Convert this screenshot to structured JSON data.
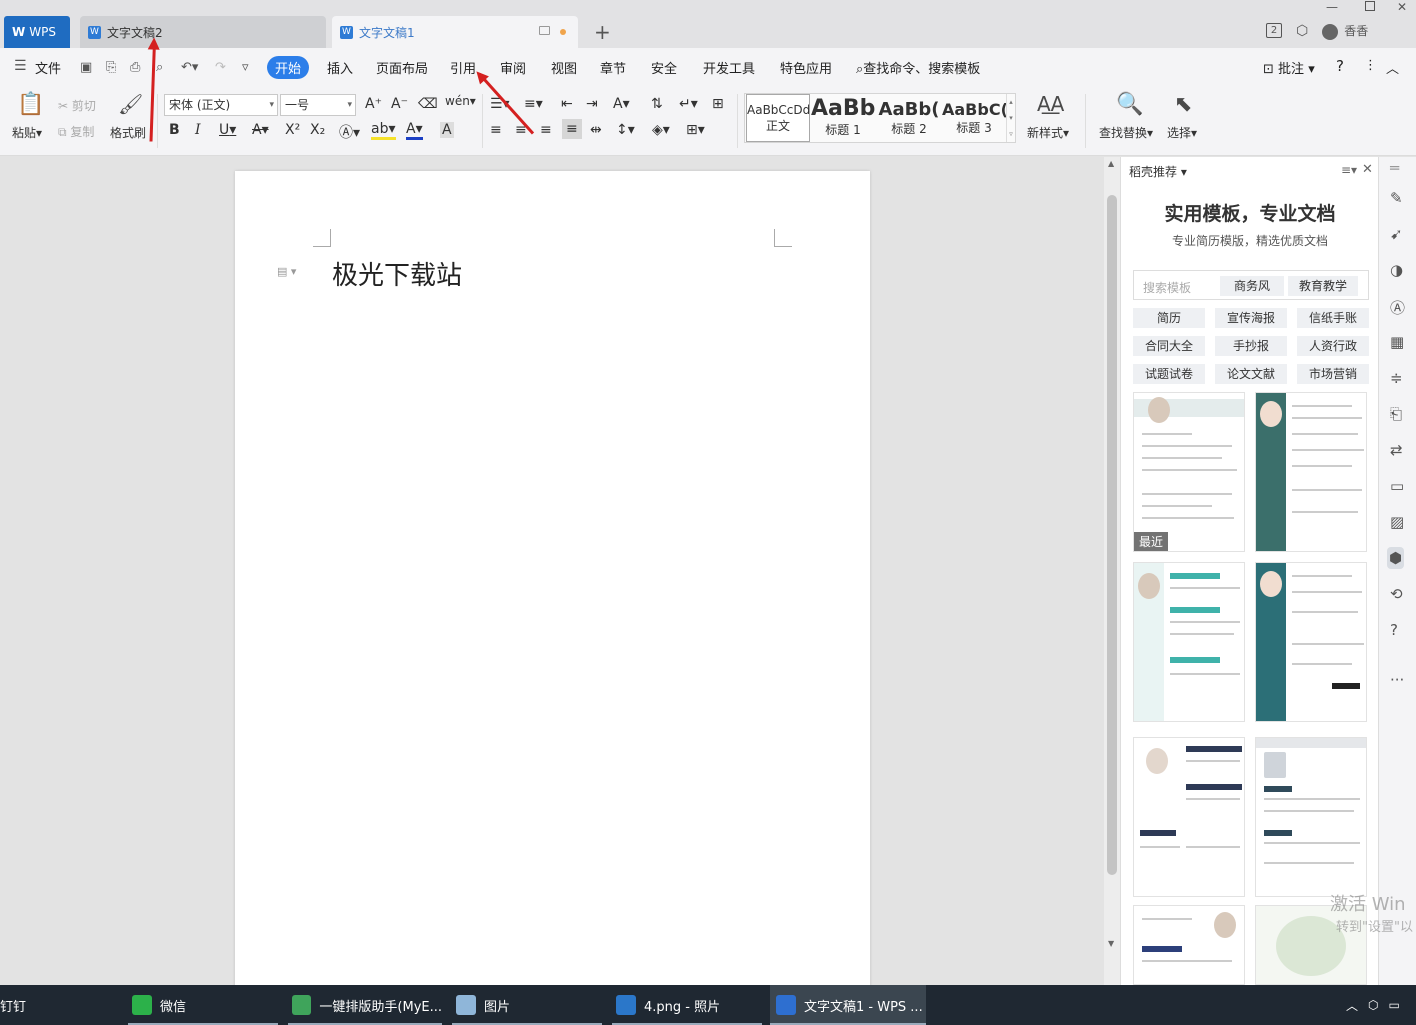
{
  "tabs": {
    "wps": "WPS",
    "doc2": "文字文稿2",
    "doc1": "文字文稿1",
    "new_tab_icon": "plus-icon"
  },
  "window": {
    "badge": "2",
    "user": "香香"
  },
  "menu": {
    "file": "文件",
    "items": [
      "开始",
      "插入",
      "页面布局",
      "引用",
      "审阅",
      "视图",
      "章节",
      "安全",
      "开发工具",
      "特色应用"
    ],
    "search": "查找命令、搜索模板",
    "comment": "批注",
    "help": "?"
  },
  "ribbon": {
    "paste": "粘贴",
    "cut": "剪切",
    "copy": "复制",
    "format_painter": "格式刷",
    "font_name": "宋体 (正文)",
    "font_size": "一号",
    "bold": "B",
    "italic": "I",
    "underline": "U",
    "styles": [
      {
        "preview": "AaBbCcDd",
        "caption": "正文"
      },
      {
        "preview": "AaBb",
        "caption": "标题 1"
      },
      {
        "preview": "AaBb(",
        "caption": "标题 2"
      },
      {
        "preview": "AaBbC(",
        "caption": "标题 3"
      }
    ],
    "new_style": "新样式",
    "find_replace": "查找替换",
    "select": "选择"
  },
  "document": {
    "body_text": "极光下载站"
  },
  "panel": {
    "title": "稻壳推荐",
    "heading": "实用模板，专业文档",
    "subheading": "专业简历模版，精选优质文档",
    "search_placeholder": "搜索模板",
    "search_tags": [
      "商务风",
      "教育教学"
    ],
    "categories": [
      "简历",
      "宣传海报",
      "信纸手账",
      "合同大全",
      "手抄报",
      "人资行政",
      "试题试卷",
      "论文文献",
      "市场营销"
    ],
    "recent_label": "最近"
  },
  "taskbar": {
    "items": [
      "钉钉",
      "微信",
      "一键排版助手(MyE...",
      "图片",
      "4.png - 照片",
      "文字文稿1 - WPS ..."
    ]
  },
  "watermark": {
    "line1": "激活 Win",
    "line2": "转到\"设置\"以"
  },
  "colors": {
    "accent": "#2c7ee9",
    "taskbar": "#1f2832",
    "annotation_arrow": "#d42020"
  }
}
